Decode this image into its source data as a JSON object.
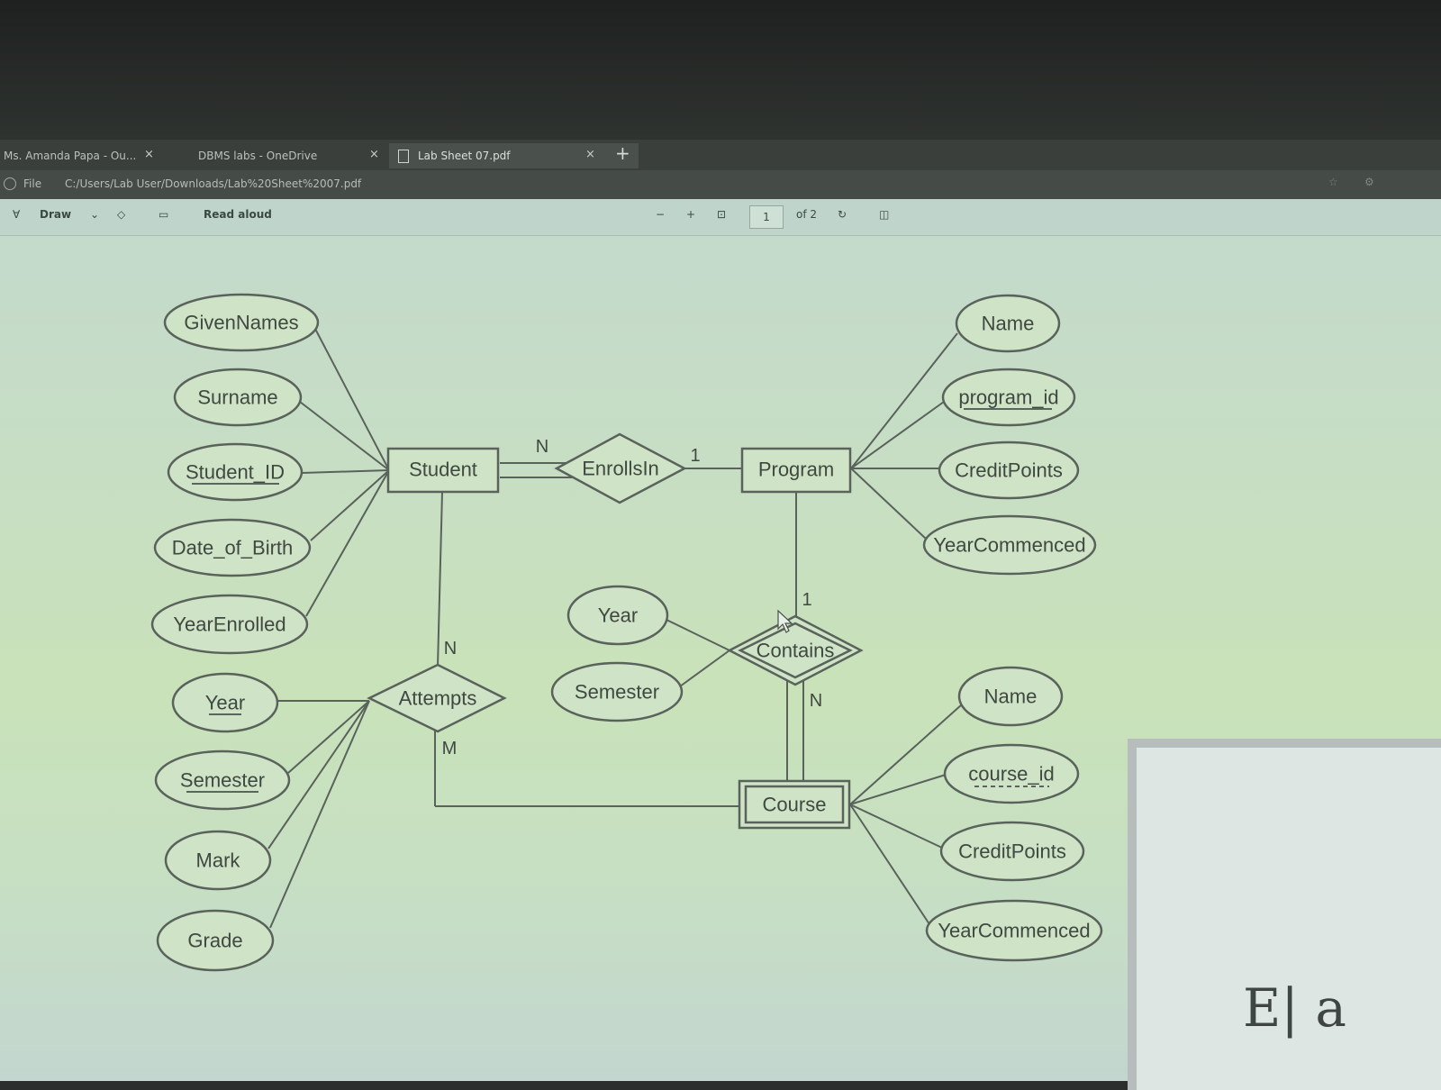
{
  "browser": {
    "tabs": [
      {
        "label": "Ms. Amanda Papa - Ou...",
        "active": false
      },
      {
        "label": "DBMS labs - OneDrive",
        "active": false
      },
      {
        "label": "Lab Sheet 07.pdf",
        "active": true
      }
    ],
    "new_tab_symbol": "+",
    "close_symbol": "×",
    "address_scheme": "File",
    "address_path": "C:/Users/Lab User/Downloads/Lab%20Sheet%2007.pdf"
  },
  "pdf_toolbar": {
    "draw_label": "Draw",
    "read_aloud_label": "Read aloud",
    "zoom_out": "−",
    "zoom_in": "+",
    "page_number": "1",
    "page_count": "of 2"
  },
  "diagram": {
    "entities": {
      "student": "Student",
      "program": "Program",
      "course": "Course"
    },
    "relationships": {
      "enrollsin": "EnrollsIn",
      "contains": "Contains",
      "attempts": "Attempts"
    },
    "attributes": {
      "givennames": "GivenNames",
      "surname": "Surname",
      "student_id": "Student_ID",
      "date_of_birth": "Date_of_Birth",
      "yearenrolled": "YearEnrolled",
      "att_year": "Year",
      "att_semester": "Semester",
      "mark": "Mark",
      "grade": "Grade",
      "prog_name": "Name",
      "program_id": "program_id",
      "prog_creditpoints": "CreditPoints",
      "prog_yearcommenced": "YearCommenced",
      "cont_year": "Year",
      "cont_semester": "Semester",
      "course_name": "Name",
      "course_id": "course_id",
      "course_creditpoints": "CreditPoints",
      "course_yearcommenced": "YearCommenced"
    },
    "cardinalities": {
      "student_enroll": "N",
      "enroll_program": "1",
      "program_contains": "1",
      "contains_course": "N",
      "student_attempts": "N",
      "attempts_course": "M"
    }
  },
  "whiteboard": {
    "handwriting": "E| a"
  }
}
